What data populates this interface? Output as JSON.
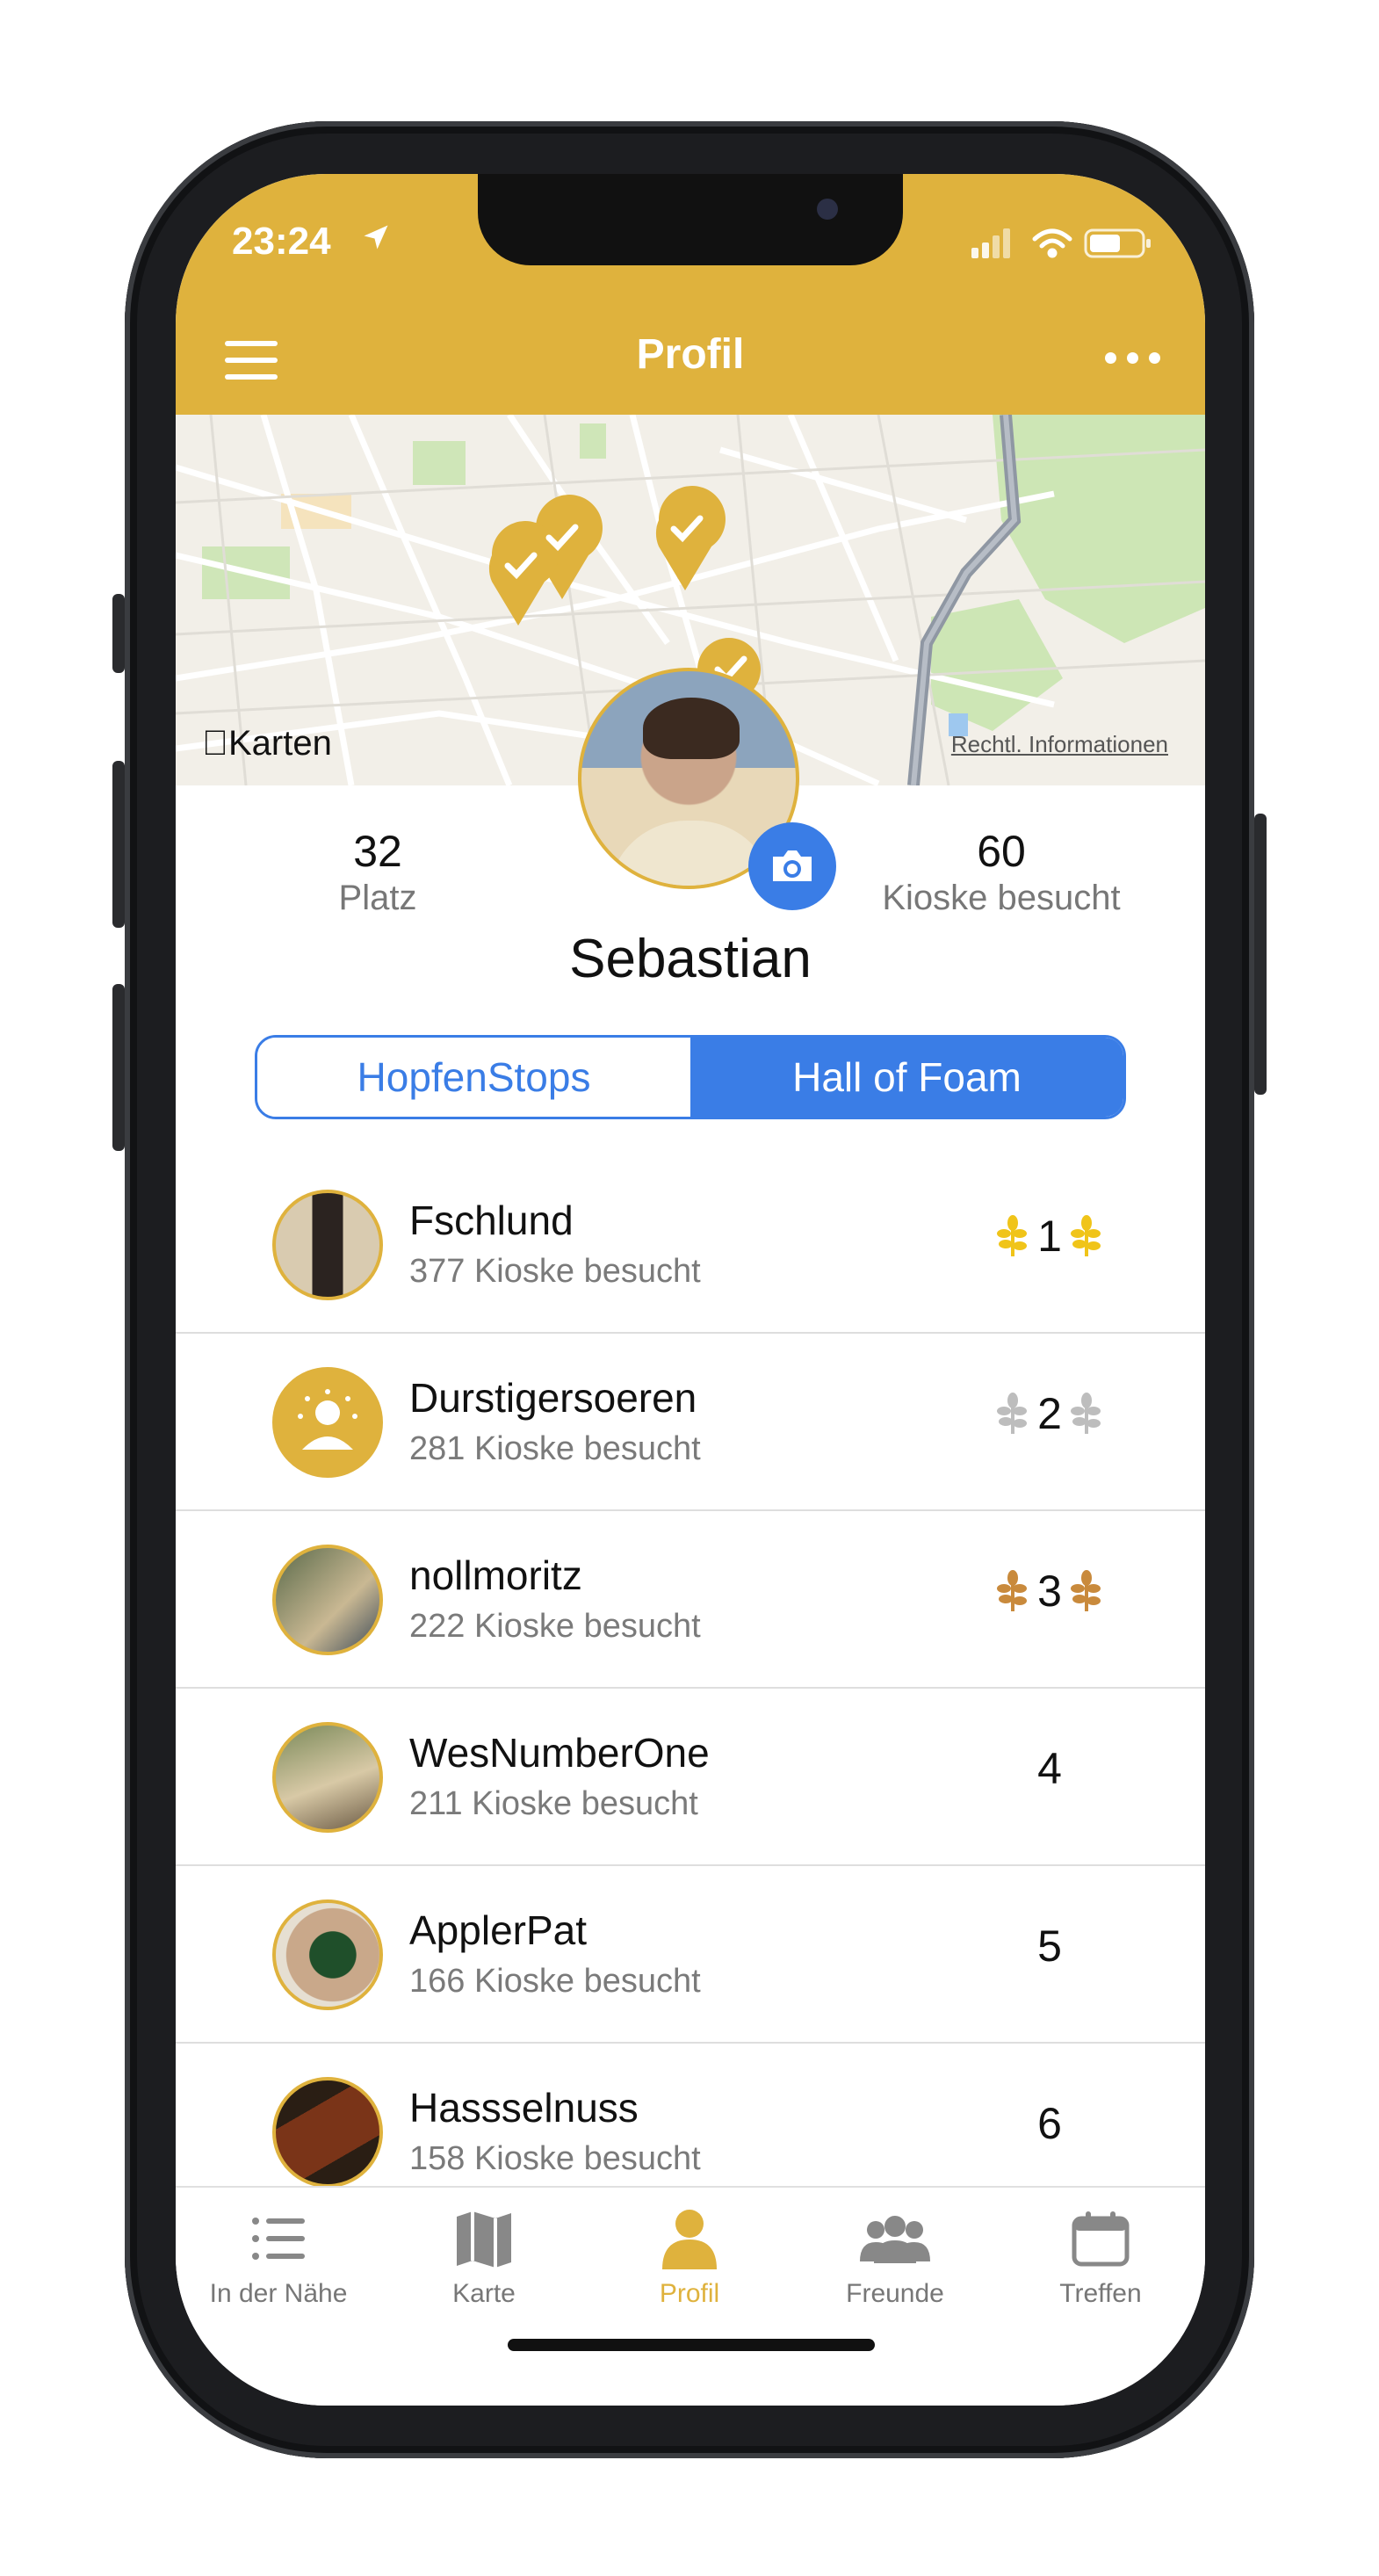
{
  "status": {
    "time": "23:24"
  },
  "nav": {
    "title": "Profil"
  },
  "map": {
    "brand": "Karten",
    "legal": "Rechtl. Informationen"
  },
  "profile": {
    "rank_value": "32",
    "rank_label": "Platz",
    "kioske_value": "60",
    "kioske_label": "Kioske besucht",
    "name": "Sebastian"
  },
  "segments": [
    "HopfenStops",
    "Hall of Foam"
  ],
  "leaderboard": [
    {
      "name": "Fschlund",
      "sub": "377 Kioske besucht",
      "rank": "1"
    },
    {
      "name": "Durstigersoeren",
      "sub": "281 Kioske besucht",
      "rank": "2"
    },
    {
      "name": "nollmoritz",
      "sub": "222 Kioske besucht",
      "rank": "3"
    },
    {
      "name": "WesNumberOne",
      "sub": "211 Kioske besucht",
      "rank": "4"
    },
    {
      "name": "ApplerPat",
      "sub": "166 Kioske besucht",
      "rank": "5"
    },
    {
      "name": "Hassselnuss",
      "sub": "158 Kioske besucht",
      "rank": "6"
    }
  ],
  "tabs": [
    "In der Nähe",
    "Karte",
    "Profil",
    "Freunde",
    "Treffen"
  ],
  "colors": {
    "accent": "#dfb23d",
    "blue": "#3a7de6",
    "gold": "#f0c419",
    "silver": "#bdbdbd",
    "bronze": "#c98a3c"
  }
}
